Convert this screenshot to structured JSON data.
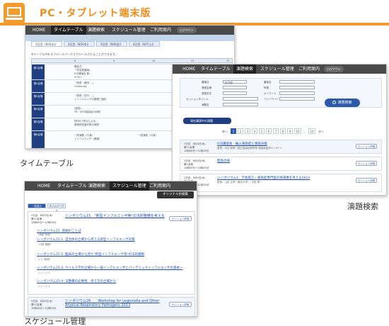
{
  "header": {
    "title": "PC・タブレット端末版"
  },
  "captions": {
    "timetable": "タイムテーブル",
    "search": "演題検索",
    "schedule": "スケジュール管理"
  },
  "timetable": {
    "nav": [
      "HOME",
      "タイムテーブル",
      "演題検索",
      "スケジュール管理",
      "ご利用案内"
    ],
    "logout": "ログアウト",
    "note": "※テーブル内をスクロールバーでスクロールさせることができます。",
    "day_tabs": [
      "1日目（6/4(水)）",
      "2日目（6/5(木)）",
      "3日目（6/6(金)）",
      "4日目（6/7(土)）"
    ],
    "hours": [
      "8",
      "9",
      "10",
      "11",
      "12"
    ],
    "rooms": [
      {
        "name": "第1会場",
        "lines": [
          "開会式",
          "「学会長講演」",
          "ICD講演会 藤…",
          "（レンタル）",
          "9:30～"
        ]
      },
      {
        "name": "第2会場",
        "lines": [
          "「座長・藤田 …」",
          "Continuity"
        ]
      },
      {
        "name": "第3会場",
        "lines": [
          "「座長・田中 …」",
          "インフルエンザの基礎と臨床"
        ]
      },
      {
        "name": "第4会場",
        "lines": [
          "(座長)",
          "TB・NTM感染症の診断"
        ]
      },
      {
        "name": "第5会場",
        "lines": [
          "院内ICT担当による…",
          "薬剤耐性菌対策の実際"
        ]
      },
      {
        "name": "第6会場",
        "lines": [
          "一般演題（口演）",
          "一般演題（口演）",
          "インフルエンザ（基礎）"
        ]
      }
    ]
  },
  "search": {
    "nav": [
      "HOME",
      "タイムテーブル",
      "演題検索",
      "スケジュール管理",
      "ご利用案内"
    ],
    "logout": "ログアウト",
    "fields": [
      "講演日",
      "発表会場",
      "発表形式",
      "セッションタイトル",
      "演題名",
      "著者名",
      "所属",
      "キーワード",
      "フリーワード"
    ],
    "select_default": "全日程",
    "button": "演題検索",
    "current_btn": "現在講演中の演題",
    "pages": [
      "1",
      "2",
      "3",
      "4",
      "5",
      "6",
      "7",
      "8",
      "9",
      "10",
      "…",
      "14"
    ],
    "prev": "前へ",
    "next": "次へ",
    "results": [
      {
        "when": "1日目　6月4日(水)",
        "room": "第11会場",
        "time": "10時00分〜11時30分",
        "title": "ICD講習会　輸入感染症と感染対策",
        "sub": "座長：大石 和徳（国立感染症研究所 感染症疫学センター）",
        "btn": "セッション詳細"
      },
      {
        "when": "1日目　6月4日(水)",
        "room": "第1会場",
        "time": "10時00分〜10時30分",
        "title": "開会の辞",
        "sub": "",
        "btn": "セッション詳細"
      },
      {
        "when": "2日目　6月5日(木)",
        "room": "第1会場",
        "time": "10時00分〜11時30分",
        "title": "シンポジウム1：学会提言・感染症専門医の将来像を考える2013",
        "sub": "座長：山田 正和（東京大学）・平松 啓一",
        "btn": "セッション詳細"
      }
    ]
  },
  "schedule": {
    "nav": [
      "HOME",
      "タイムテーブル",
      "演題検索",
      "スケジュール管理",
      "ご利用案内"
    ],
    "badge": "オリジナル抄録集",
    "tabs": [
      "一覧表示",
      "タイムテーブル"
    ],
    "block1": {
      "when": "2日目　6月5日(木)",
      "room": "第11会場",
      "time": "10時00分〜12時00分",
      "title": "シンポジウム15　\"新型インフルエンザ等\"の法的整備を考える",
      "bullets": [
        "シンポジウム15. 冒頭のことば",
        "シンポジウム15-1. 自治体の立場から考える新型インフルエンザ対策",
        "シンポジウム15-2. 臨床の立場から見た\"新型インフルエンザ等\"の法的規制",
        "シンポジウム15-3. ウイルス学の立場から一般インフルエンザとパンデミックインフルエンザの基本～",
        "シンポジウム15-4. 法整備の必要性、考え方の立場から"
      ],
      "authors": [
        "（岡部 信彦）",
        "（小林 春樹）",
        "（○○ 和彦）",
        "（○○ ○○）",
        "（○○ ○○）"
      ],
      "btn": "セッション詳細"
    },
    "block2": {
      "when": "2日目　6月5日(木)",
      "room": "第11会場",
      "time": "10時00分〜12時00分",
      "title": "シンポジウム26　　Workshop for Legionella and Other Atypical Respiratory Pathogens 2013",
      "btn": "セッション詳細"
    }
  }
}
